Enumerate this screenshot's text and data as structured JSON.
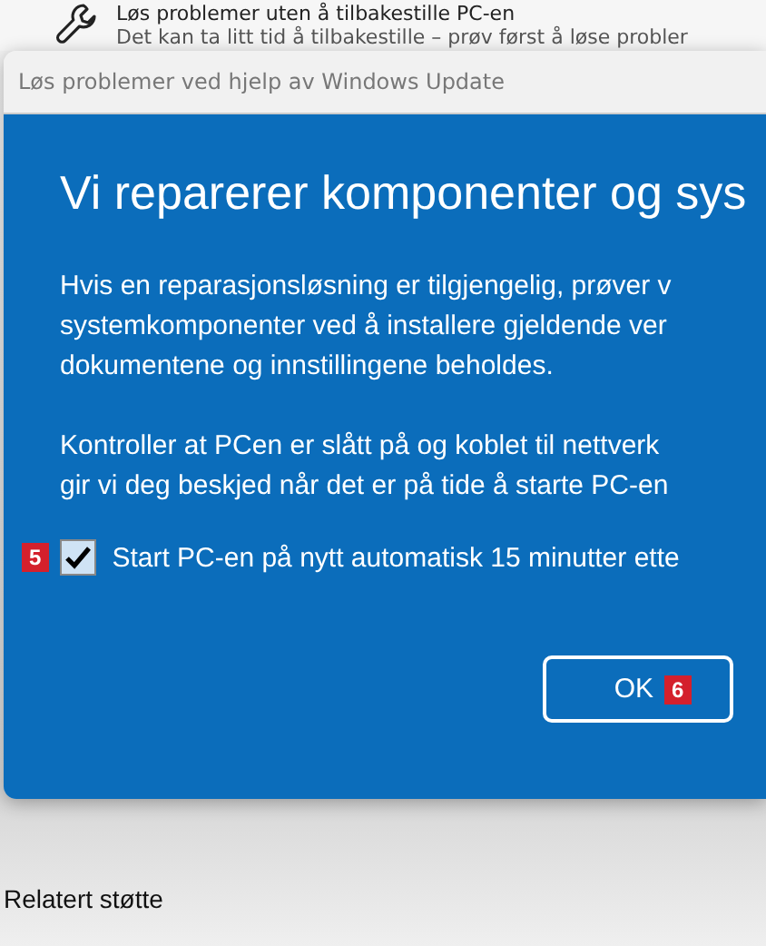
{
  "background": {
    "item_title": "Løs problemer uten å tilbakestille PC-en",
    "item_description": "Det kan ta litt tid å tilbakestille – prøv først å løse probler",
    "section_heading": "Relatert støtte"
  },
  "dialog": {
    "title": "Løs problemer ved hjelp av Windows Update",
    "heading": "Vi reparerer komponenter og sys",
    "paragraphs": [
      [
        "Hvis en reparasjonsløsning er tilgjengelig, prøver v",
        "systemkomponenter ved å installere gjeldende ver",
        "dokumentene og innstillingene beholdes."
      ],
      [
        "Kontroller at PCen er slått på og koblet til nettverk",
        "gir vi deg beskjed når det er på tide å starte PC-en"
      ]
    ],
    "checkbox": {
      "label": "Start PC-en på nytt automatisk 15 minutter ette",
      "checked": true,
      "badge": "5"
    },
    "ok_button": {
      "label": "OK",
      "badge": "6"
    }
  }
}
